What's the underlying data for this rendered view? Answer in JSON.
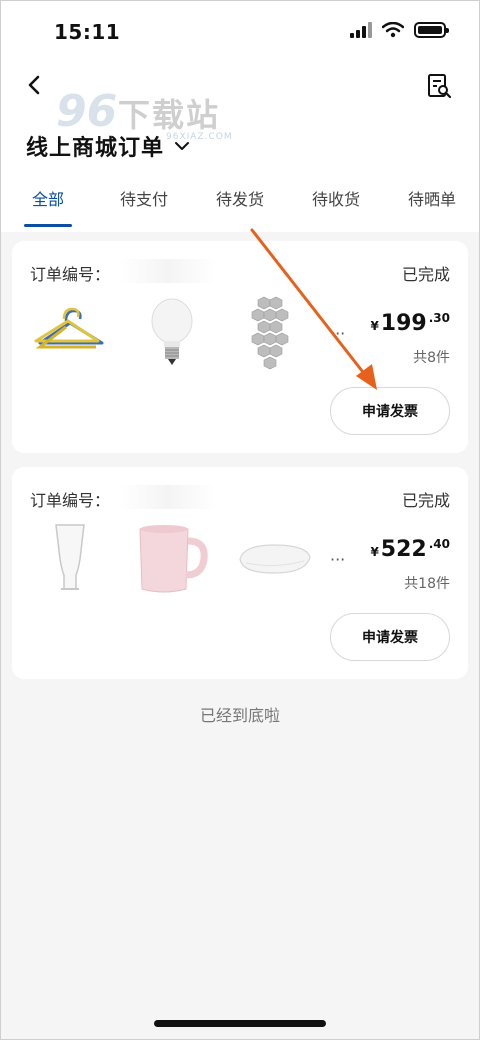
{
  "status_bar": {
    "time": "15:11"
  },
  "header": {
    "title": "线上商城订单",
    "watermark": {
      "number": "96",
      "text": "下载站",
      "sub": "96XIAZ.COM"
    }
  },
  "tabs": [
    {
      "label": "全部",
      "active": true
    },
    {
      "label": "待支付",
      "active": false
    },
    {
      "label": "待发货",
      "active": false
    },
    {
      "label": "待收货",
      "active": false
    },
    {
      "label": "待晒单",
      "active": false
    }
  ],
  "orders": [
    {
      "order_label": "订单编号：",
      "status": "已完成",
      "price_currency": "¥",
      "price_int": "199",
      "price_dec": ".30",
      "count": "共8件",
      "items": [
        "hanger-icon",
        "lightbulb-icon",
        "hexagon-panel-icon"
      ],
      "more": "···",
      "button": "申请发票"
    },
    {
      "order_label": "订单编号：",
      "status": "已完成",
      "price_currency": "¥",
      "price_int": "522",
      "price_dec": ".40",
      "count": "共18件",
      "items": [
        "glass-icon",
        "mug-icon",
        "pillow-icon"
      ],
      "more": "···",
      "button": "申请发票"
    }
  ],
  "footer": {
    "end_text": "已经到底啦"
  },
  "colors": {
    "accent": "#0a4fa3",
    "arrow": "#e8611c"
  }
}
